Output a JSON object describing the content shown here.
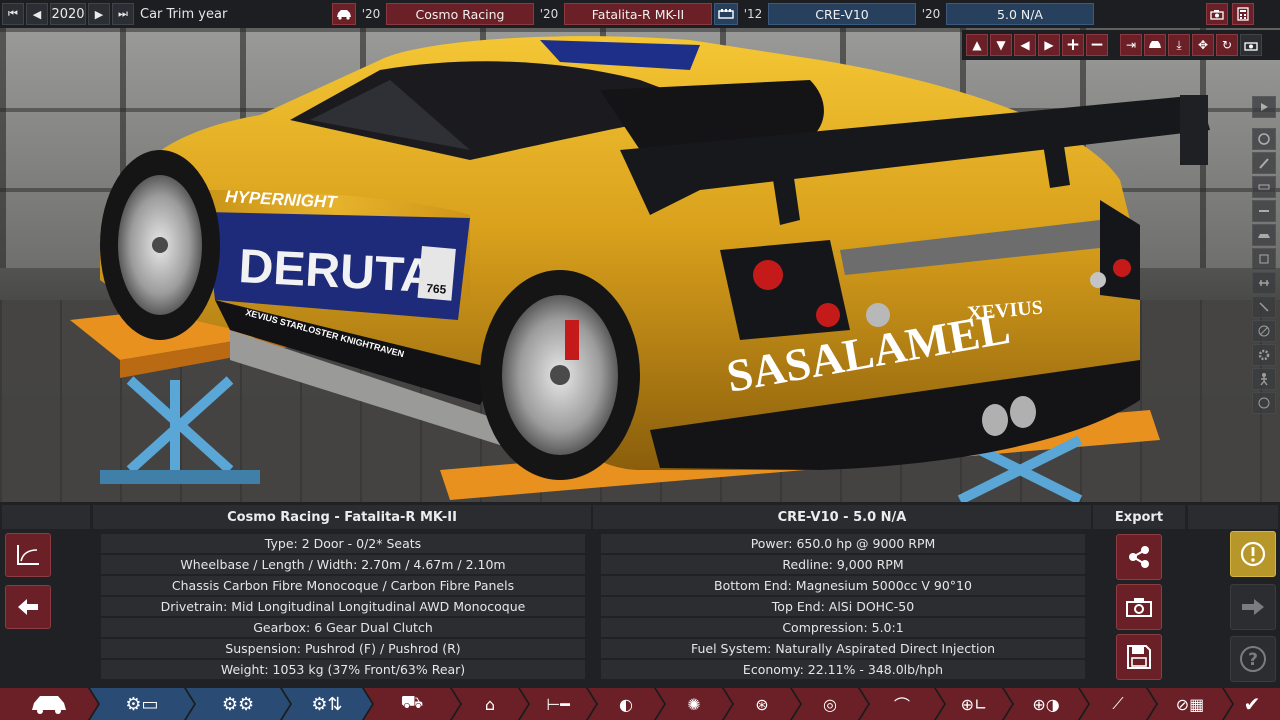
{
  "topbar": {
    "year": "2020",
    "year_label": "Car Trim year",
    "trim_year": "'20",
    "company": "Cosmo Racing",
    "model_year": "'20",
    "model": "Fatalita-R MK-II",
    "engine_family_year": "'12",
    "engine_family": "CRE-V10",
    "engine_variant_year": "'20",
    "engine_variant": "5.0 N/A"
  },
  "car_livery": {
    "sponsor_side_top": "HYPERNIGHT",
    "sponsor_side_main": "DERUTA",
    "sponsor_side_strip": "XEVIUS  STARLOSTER  KNIGHTRAVEN",
    "race_number": "765",
    "sponsor_rear_small": "XEVIUS",
    "sponsor_rear_main": "SASALAMEL"
  },
  "car_info": {
    "title": "Cosmo Racing - Fatalita-R MK-II",
    "rows": [
      "Type: 2 Door - 0/2* Seats",
      "Wheelbase / Length / Width: 2.70m / 4.67m / 2.10m",
      "Chassis Carbon Fibre Monocoque / Carbon Fibre Panels",
      "Drivetrain: Mid Longitudinal Longitudinal AWD Monocoque",
      "Gearbox: 6 Gear Dual Clutch",
      "Suspension: Pushrod (F) / Pushrod (R)",
      "Weight: 1053 kg (37% Front/63% Rear)"
    ]
  },
  "engine_info": {
    "title": "CRE-V10 - 5.0 N/A",
    "rows": [
      "Power: 650.0 hp @ 9000 RPM",
      "Redline:  9,000 RPM",
      "Bottom End: Magnesium 5000cc V 90°10",
      "Top End: AlSi DOHC-50",
      "Compression: 5.0:1",
      "Fuel System: Naturally Aspirated Direct Injection",
      "Economy: 22.11% - 348.0lb/hph"
    ]
  },
  "export": {
    "title": "Export"
  },
  "colors": {
    "accent_maroon": "#6a2026",
    "accent_navy": "#27405e",
    "nav_blue": "#2a4b73",
    "warning_yellow": "#b8972a",
    "car_gold": "#d9a01c",
    "lift_orange": "#e9911e",
    "lift_blue": "#5aa6d6"
  },
  "icons": {
    "top_left": [
      "skip-back-icon",
      "prev-icon",
      "next-icon",
      "skip-forward-icon"
    ],
    "top_right": [
      "camera-icon",
      "calculator-icon"
    ],
    "tools": [
      "arrow-up-icon",
      "arrow-down-icon",
      "arrow-left-icon",
      "arrow-right-icon",
      "zoom-in-icon",
      "zoom-out-icon",
      "align-right-icon",
      "car-view-icon",
      "lower-icon",
      "gizmo-icon",
      "rotate-icon",
      "screenshot-icon"
    ]
  }
}
